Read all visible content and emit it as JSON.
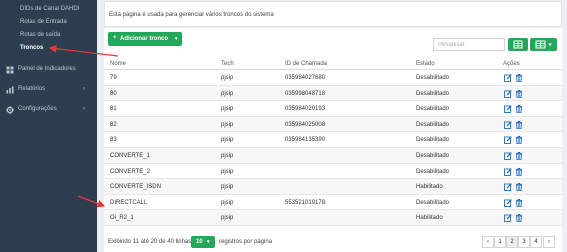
{
  "sidebar": {
    "sub_items": [
      {
        "label": "DIDs de Canal DAHDI"
      },
      {
        "label": "Rotas de Entrada"
      },
      {
        "label": "Rotas de saída"
      },
      {
        "label": "Troncos"
      }
    ],
    "menu": [
      {
        "label": "Painel de Indicadores",
        "icon": "dashboard-icon"
      },
      {
        "label": "Relatórios",
        "icon": "bar-chart-icon"
      },
      {
        "label": "Configurações",
        "icon": "gear-icon"
      }
    ]
  },
  "info": {
    "text": "Esta página é usada para gerenciar vários troncos do sistema"
  },
  "toolbar": {
    "add_label": "Adicionar tronco",
    "search_placeholder": "Pesquisar"
  },
  "table": {
    "columns": [
      "Nome",
      "Tech",
      "ID de Chamada",
      "Estado",
      "Ações"
    ],
    "rows": [
      {
        "nome": "79",
        "tech": "pjsip",
        "id": "035984027680",
        "estado": "Desabilitado"
      },
      {
        "nome": "80",
        "tech": "pjsip",
        "id": "035998048718",
        "estado": "Desabilitado"
      },
      {
        "nome": "81",
        "tech": "pjsip",
        "id": "035984020193",
        "estado": "Desabilitado"
      },
      {
        "nome": "82",
        "tech": "pjsip",
        "id": "035984025008",
        "estado": "Desabilitado"
      },
      {
        "nome": "83",
        "tech": "pjsip",
        "id": "035984135390",
        "estado": "Desabilitado"
      },
      {
        "nome": "CONVERTE_1",
        "tech": "pjsip",
        "id": "",
        "estado": "Desabilitado"
      },
      {
        "nome": "CONVERTE_2",
        "tech": "pjsip",
        "id": "",
        "estado": "Desabilitado"
      },
      {
        "nome": "CONVERTE_ISDN",
        "tech": "pjsip",
        "id": "",
        "estado": "Habilitado"
      },
      {
        "nome": "DIRECTCALL",
        "tech": "pjsip",
        "id": "553521019178",
        "estado": "Desabilitado"
      },
      {
        "nome": "Oi_R2_1",
        "tech": "pjsip",
        "id": "",
        "estado": "Habilitado"
      }
    ]
  },
  "footer": {
    "showing": "Exibindo 11 até 20 de 40 linhas",
    "per_page_value": "10",
    "per_page_label": "registros por página",
    "pages": [
      "‹",
      "1",
      "2",
      "3",
      "4",
      "›"
    ],
    "active_page": "2"
  },
  "colors": {
    "sidebar_bg": "#2c3e50",
    "accent_green": "#26a65b",
    "action_blue": "#1e6fb8",
    "arrow_red": "#e53935"
  }
}
